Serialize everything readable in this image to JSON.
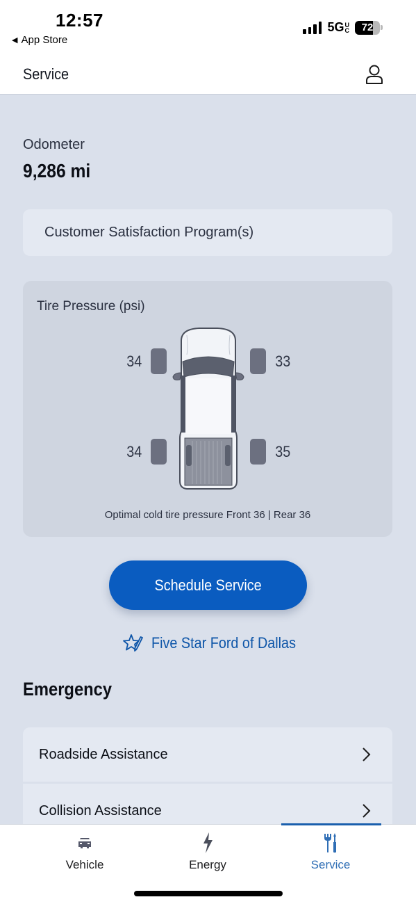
{
  "status_bar": {
    "time": "12:57",
    "back_app": "App Store",
    "network": "5G",
    "network_suffix": "UC",
    "battery_level": "72",
    "battery_percent": 72,
    "signal_bars": 4
  },
  "header": {
    "title": "Service",
    "profile_icon": "person-icon"
  },
  "odometer": {
    "label": "Odometer",
    "value": "9,286 mi"
  },
  "csp": {
    "label": "Customer Satisfaction Program(s)"
  },
  "tire_pressure": {
    "title": "Tire Pressure (psi)",
    "front_left": "34",
    "front_right": "33",
    "rear_left": "34",
    "rear_right": "35",
    "note": "Optimal cold tire pressure Front 36 | Rear 36"
  },
  "schedule_button": {
    "label": "Schedule Service",
    "color": "#0a5cc0"
  },
  "dealer": {
    "name": "Five Star Ford of Dallas",
    "icon": "star-pencil-icon"
  },
  "emergency": {
    "title": "Emergency",
    "items": [
      {
        "label": "Roadside Assistance"
      },
      {
        "label": "Collision Assistance"
      }
    ]
  },
  "tabs": [
    {
      "label": "Vehicle",
      "icon": "car-icon",
      "active": false
    },
    {
      "label": "Energy",
      "icon": "lightning-icon",
      "active": false
    },
    {
      "label": "Service",
      "icon": "tools-icon",
      "active": true
    }
  ],
  "colors": {
    "accent": "#0a5cc0",
    "active_tab": "#2f6eb5",
    "background": "#dae0eb"
  }
}
